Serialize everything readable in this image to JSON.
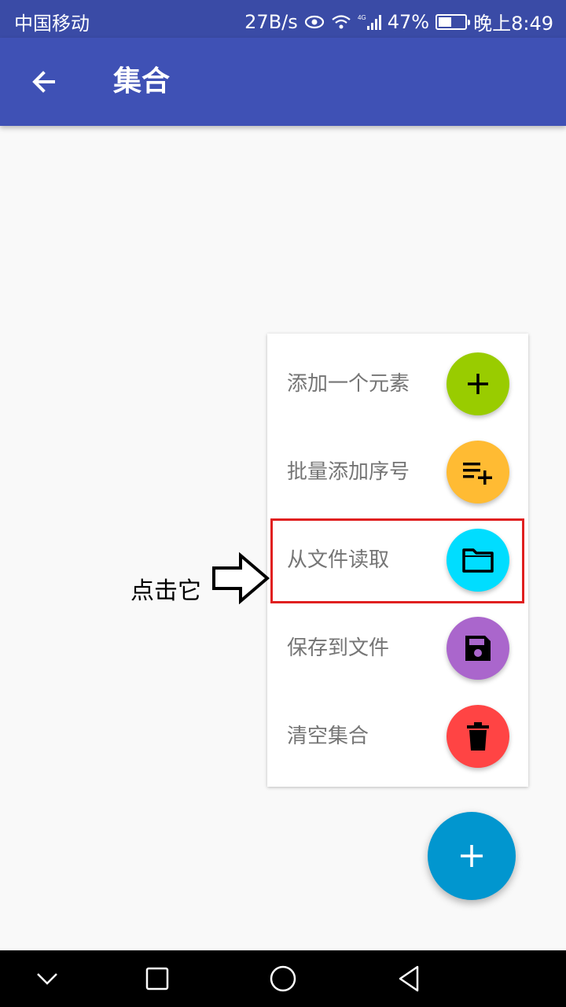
{
  "status_bar": {
    "carrier": "中国移动",
    "speed": "27B/s",
    "network": "4G",
    "battery": "47%",
    "time": "晚上8:49"
  },
  "app_bar": {
    "title": "集合",
    "back_icon": "arrow-back-icon"
  },
  "menu": {
    "items": [
      {
        "label": "添加一个元素",
        "icon": "plus-icon",
        "color": "#99cc00"
      },
      {
        "label": "批量添加序号",
        "icon": "playlist-add-icon",
        "color": "#ffbb33"
      },
      {
        "label": "从文件读取",
        "icon": "folder-icon",
        "color": "#00ddff"
      },
      {
        "label": "保存到文件",
        "icon": "save-icon",
        "color": "#aa66cc"
      },
      {
        "label": "清空集合",
        "icon": "delete-icon",
        "color": "#ff4444"
      }
    ]
  },
  "annotation": {
    "text": "点击它"
  },
  "fab": {
    "icon": "plus-icon",
    "color": "#0196cf"
  },
  "nav_bar": {
    "buttons": [
      "chevron-down-icon",
      "recents-square-icon",
      "home-circle-icon",
      "back-triangle-icon"
    ]
  }
}
